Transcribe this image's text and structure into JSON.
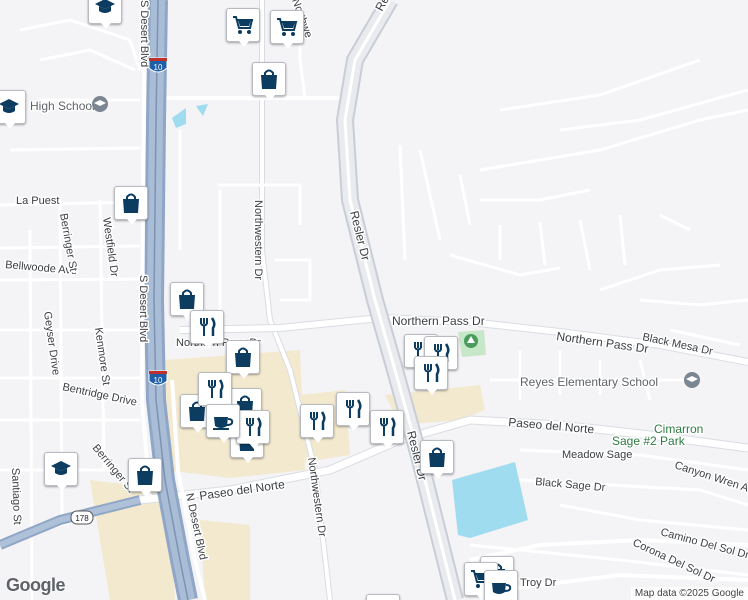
{
  "map": {
    "attribution": "Map data ©2025 Google",
    "logo": "Google",
    "colors": {
      "background": "#f4f3f6",
      "road": "#ffffff",
      "highway": "#8fa6c6",
      "highway_core": "#9db3d1",
      "arterial": "#d9dde3",
      "commercial": "#f3e9cf",
      "water": "#9fdcf0",
      "park": "#c6e8c8",
      "marker_icon": "#0d3c61"
    },
    "roads": {
      "resler_north": "Resler",
      "resler": "Resler Dr",
      "resler_south": "Resler Dr",
      "northwestern": "Northwestern Dr",
      "northwestern_south": "Northwestern Dr",
      "northwestern_north": "Northwe",
      "s_desert": "S Desert Blvd",
      "s_desert_north": "S Desert Blvd",
      "n_desert": "N Desert Blvd",
      "northern_pass": "Northern Pass Dr",
      "northern_pass_east": "Northern Pass Dr",
      "northern_pass_west": "Northern Pass Dr",
      "paseo_west": "Paseo del Norte",
      "paseo_east": "Paseo del Norte",
      "black_mesa": "Black Mesa Dr",
      "meadow_sage": "Meadow Sage",
      "black_sage": "Black Sage Dr",
      "canyon_wren": "Canyon Wren Ave",
      "camino_del_sol": "Camino Del Sol Dr",
      "corona_del_sol": "Corona Del Sol Dr",
      "troy": "Troy Dr",
      "bellwoode": "Bellwoode Ave",
      "geyser": "Geyser Drive",
      "kenmore": "Kenmore St",
      "bentridge": "Bentridge Drive",
      "beringer_north": "Berringer St",
      "beringer_south": "Berringer St",
      "westfield": "Westfield Dr",
      "la_puesta": "La Puest",
      "santiago": "Santiago St"
    },
    "shields": {
      "i10_north": "10",
      "i10_south": "10",
      "sr178": "178"
    },
    "pois": {
      "high_school": "High School",
      "reyes": "Reyes Elementary School",
      "cimarron_1": "Cimarron",
      "cimarron_2": "Sage #2 Park"
    },
    "icons": {
      "school": "graduation-cap-icon",
      "shopping_cart": "shopping-cart-icon",
      "shopping_bag": "shopping-bag-icon",
      "restaurant": "fork-knife-icon",
      "cafe": "coffee-cup-icon",
      "park": "tree-icon"
    }
  }
}
